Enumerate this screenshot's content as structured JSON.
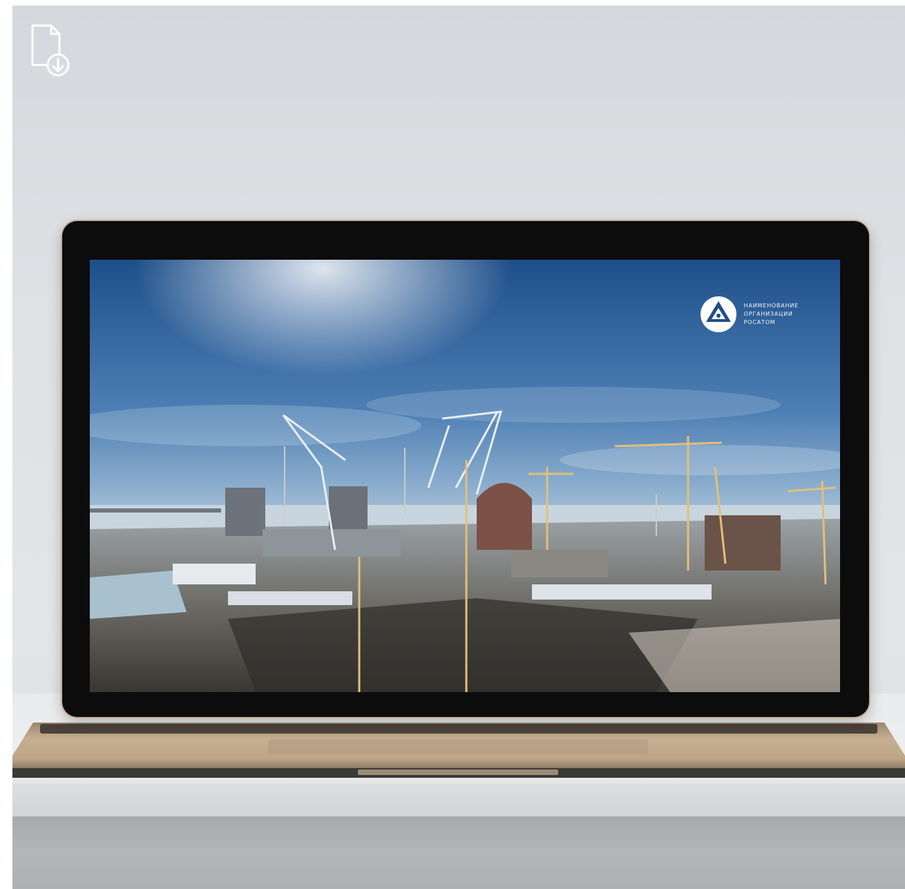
{
  "scene": {
    "background_color": "#dfe2e5",
    "shelf_color": "#eceeef"
  },
  "toolbar": {
    "download_icon": "file-download-icon"
  },
  "laptop": {
    "bezel_color": "#0c0c0d",
    "body_color": "#c9b39a"
  },
  "screen": {
    "wallpaper": "nuclear-plant-construction-site",
    "logo": {
      "icon": "rosatom-logo-icon",
      "lines": [
        "НАИМЕНОВАНИЕ",
        "ОРГАНИЗАЦИИ",
        "РОСАТОМ"
      ]
    }
  }
}
